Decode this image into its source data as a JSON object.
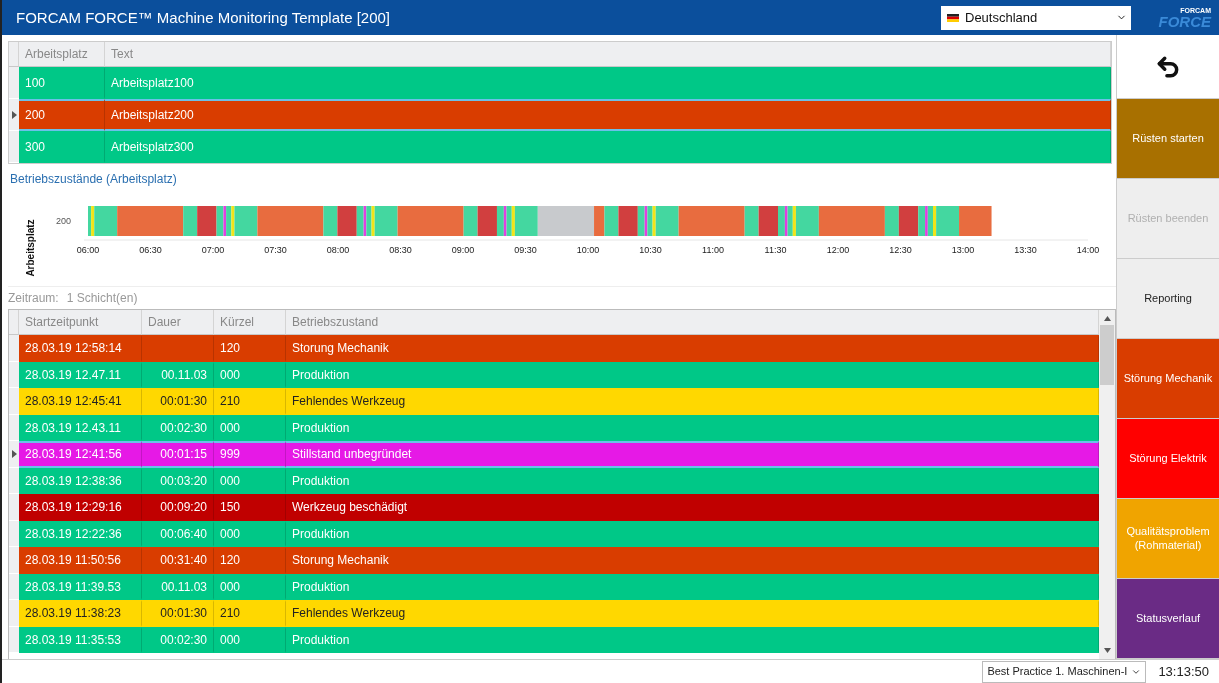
{
  "window": {
    "title": "FORCAM FORCE™ Machine Monitoring Template [200]"
  },
  "language_select": {
    "value": "Deutschland"
  },
  "logo": {
    "small": "FORCAM",
    "large": "FORCE"
  },
  "workplaces": {
    "columns": [
      "Arbeitsplatz",
      "Text"
    ],
    "rows": [
      {
        "cells": [
          "100",
          "Arbeitsplatz100"
        ],
        "color": "#00c887",
        "selected": false
      },
      {
        "cells": [
          "200",
          "Arbeitsplatz200"
        ],
        "color": "#d93d00",
        "selected": true
      },
      {
        "cells": [
          "300",
          "Arbeitsplatz300"
        ],
        "color": "#00c887",
        "selected": false
      }
    ]
  },
  "timeline": {
    "title": "Betriebszustände (Arbeitsplatz)",
    "axis_label": "Arbeitsplatz",
    "row_label": "200",
    "time_labels": [
      "06:00",
      "06:30",
      "07:00",
      "07:30",
      "08:00",
      "08:30",
      "09:00",
      "09:30",
      "10:00",
      "10:30",
      "11:00",
      "11:30",
      "12:00",
      "12:30",
      "13:00",
      "13:30",
      "14:00"
    ]
  },
  "period": {
    "label": "Zeitraum:",
    "value": "1 Schicht(en)"
  },
  "events": {
    "columns": [
      "Startzeitpunkt",
      "Dauer",
      "Kürzel",
      "Betriebszustand"
    ],
    "rows": [
      {
        "cells": [
          "28.03.19 12:58:14",
          "",
          "120",
          "Storung Mechanik"
        ],
        "color": "#d93d00",
        "selected": false
      },
      {
        "cells": [
          "28.03.19 12.47.11",
          "00.11.03",
          "000",
          "Produktion"
        ],
        "color": "#00c887",
        "selected": false
      },
      {
        "cells": [
          "28.03.19 12:45:41",
          "00:01:30",
          "210",
          "Fehlendes Werkzeug"
        ],
        "color": "#ffd800",
        "selected": false
      },
      {
        "cells": [
          "28.03.19 12.43.11",
          "00:02:30",
          "000",
          "Produktion"
        ],
        "color": "#00c887",
        "selected": false
      },
      {
        "cells": [
          "28.03.19 12:41:56",
          "00:01:15",
          "999",
          "Stillstand unbegründet"
        ],
        "color": "#e619e6",
        "selected": true
      },
      {
        "cells": [
          "28.03.19 12:38:36",
          "00:03:20",
          "000",
          "Produktion"
        ],
        "color": "#00c887",
        "selected": false
      },
      {
        "cells": [
          "28.03.19 12:29:16",
          "00:09:20",
          "150",
          "Werkzeug beschädigt"
        ],
        "color": "#c00000",
        "selected": false
      },
      {
        "cells": [
          "28.03.19 12:22:36",
          "00:06:40",
          "000",
          "Produktion"
        ],
        "color": "#00c887",
        "selected": false
      },
      {
        "cells": [
          "28.03.19 11:50:56",
          "00:31:40",
          "120",
          "Storung Mechanik"
        ],
        "color": "#d93d00",
        "selected": false
      },
      {
        "cells": [
          "28.03.19 11:39.53",
          "00.11.03",
          "000",
          "Produktion"
        ],
        "color": "#00c887",
        "selected": false
      },
      {
        "cells": [
          "28.03.19 11:38:23",
          "00:01:30",
          "210",
          "Fehlendes Werkzeug"
        ],
        "color": "#ffd800",
        "selected": false
      },
      {
        "cells": [
          "28.03.19 11:35:53",
          "00:02:30",
          "000",
          "Produktion"
        ],
        "color": "#00c887",
        "selected": false
      }
    ]
  },
  "actions": [
    {
      "kind": "back",
      "disabled": false
    },
    {
      "kind": "label",
      "label": "Rüsten starten",
      "color": "#a87000",
      "disabled": false
    },
    {
      "kind": "label",
      "label": "Rüsten beenden",
      "color": "#eeeeee",
      "disabled": true
    },
    {
      "kind": "label",
      "label": "Reporting",
      "color": "#eeeeee",
      "disabled": false
    },
    {
      "kind": "label",
      "label": "Störung Mechanik",
      "color": "#d93d00",
      "disabled": false
    },
    {
      "kind": "label",
      "label": "Störung Elektrik",
      "color": "#ff0000",
      "disabled": false
    },
    {
      "kind": "label",
      "label": "Qualitätsproblem (Rohmaterial)",
      "color": "#f0a400",
      "disabled": false
    },
    {
      "kind": "label",
      "label": "Statusverlauf",
      "color": "#6a2b85",
      "disabled": false
    }
  ],
  "status_bar": {
    "template_select": "Best Practice 1. Maschinen-I",
    "time": "13:13:50"
  }
}
